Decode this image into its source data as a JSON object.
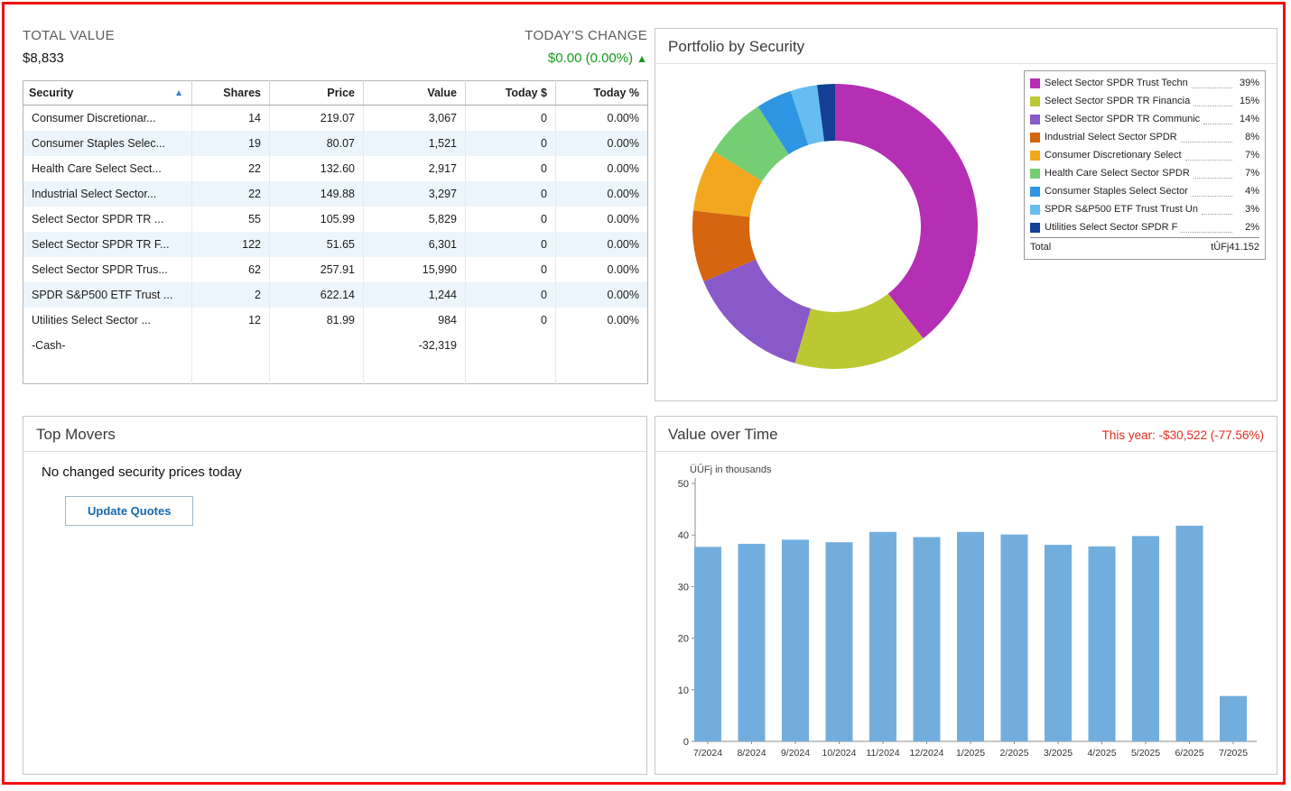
{
  "summary": {
    "total_value_label": "TOTAL VALUE",
    "total_value": "$8,833",
    "todays_change_label": "TODAY'S CHANGE",
    "todays_change": "$0.00 (0.00%)",
    "change_arrow": "▲"
  },
  "holdings_table": {
    "columns": [
      "Security",
      "Shares",
      "Price",
      "Value",
      "Today $",
      "Today %"
    ],
    "sort_arrow": "▲",
    "rows": [
      {
        "cells": [
          "Consumer Discretionar...",
          "14",
          "219.07",
          "3,067",
          "0",
          "0.00%"
        ],
        "cash": false
      },
      {
        "cells": [
          "Consumer Staples Selec...",
          "19",
          "80.07",
          "1,521",
          "0",
          "0.00%"
        ],
        "cash": false
      },
      {
        "cells": [
          "Health Care Select Sect...",
          "22",
          "132.60",
          "2,917",
          "0",
          "0.00%"
        ],
        "cash": false
      },
      {
        "cells": [
          "Industrial Select Sector...",
          "22",
          "149.88",
          "3,297",
          "0",
          "0.00%"
        ],
        "cash": false
      },
      {
        "cells": [
          "Select Sector SPDR TR ...",
          "55",
          "105.99",
          "5,829",
          "0",
          "0.00%"
        ],
        "cash": false
      },
      {
        "cells": [
          "Select Sector SPDR TR F...",
          "122",
          "51.65",
          "6,301",
          "0",
          "0.00%"
        ],
        "cash": false
      },
      {
        "cells": [
          "Select Sector SPDR Trus...",
          "62",
          "257.91",
          "15,990",
          "0",
          "0.00%"
        ],
        "cash": false
      },
      {
        "cells": [
          "SPDR S&P500 ETF Trust ...",
          "2",
          "622.14",
          "1,244",
          "0",
          "0.00%"
        ],
        "cash": false
      },
      {
        "cells": [
          "Utilities Select Sector ...",
          "12",
          "81.99",
          "984",
          "0",
          "0.00%"
        ],
        "cash": false
      },
      {
        "cells": [
          "-Cash-",
          "",
          "",
          "-32,319",
          "",
          ""
        ],
        "cash": true
      }
    ]
  },
  "portfolio_panel": {
    "title": "Portfolio by Security"
  },
  "top_movers": {
    "title": "Top Movers",
    "message": "No changed security prices today",
    "button_label": "Update Quotes"
  },
  "value_panel": {
    "title": "Value over Time",
    "this_year": "This year: -$30,522 (-77.56%)"
  },
  "chart_data": [
    {
      "type": "pie",
      "title": "Portfolio by Security",
      "labels": [
        "Select Sector SPDR Trust Techn",
        "Select Sector SPDR TR Financia",
        "Select Sector SPDR TR Communic",
        "Industrial Select Sector SPDR",
        "Consumer Discretionary Select",
        "Health Care Select Sector SPDR",
        "Consumer Staples Select Sector",
        "SPDR S&P500 ETF Trust Trust Un",
        "Utilities Select Sector SPDR F"
      ],
      "values": [
        39,
        15,
        14,
        8,
        7,
        7,
        4,
        3,
        2
      ],
      "pct_labels": [
        "39%",
        "15%",
        "14%",
        "8%",
        "7%",
        "7%",
        "4%",
        "3%",
        "2%"
      ],
      "colors": [
        "#b42fb4",
        "#bcc832",
        "#8959c9",
        "#d5650e",
        "#f2a71f",
        "#74ce74",
        "#2e96e3",
        "#66bdf0",
        "#153f94"
      ],
      "donut": true,
      "legend_position": "right",
      "total_label": "Total",
      "total_value": "tÛFj41.152"
    },
    {
      "type": "bar",
      "title": "Value over Time",
      "categories": [
        "7/2024",
        "8/2024",
        "9/2024",
        "10/2024",
        "11/2024",
        "12/2024",
        "1/2025",
        "2/2025",
        "3/2025",
        "4/2025",
        "5/2025",
        "6/2025",
        "7/2025"
      ],
      "values": [
        37.7,
        38.3,
        39.1,
        38.6,
        40.6,
        39.6,
        40.6,
        40.1,
        38.1,
        37.8,
        39.8,
        41.8,
        8.8
      ],
      "xlabel": "",
      "ylabel": "ÜÛFj in thousands",
      "ylim": [
        0,
        50
      ],
      "yticks": [
        0,
        10,
        20,
        30,
        40,
        50
      ],
      "grid": false,
      "bar_color": "#72aedd"
    }
  ]
}
